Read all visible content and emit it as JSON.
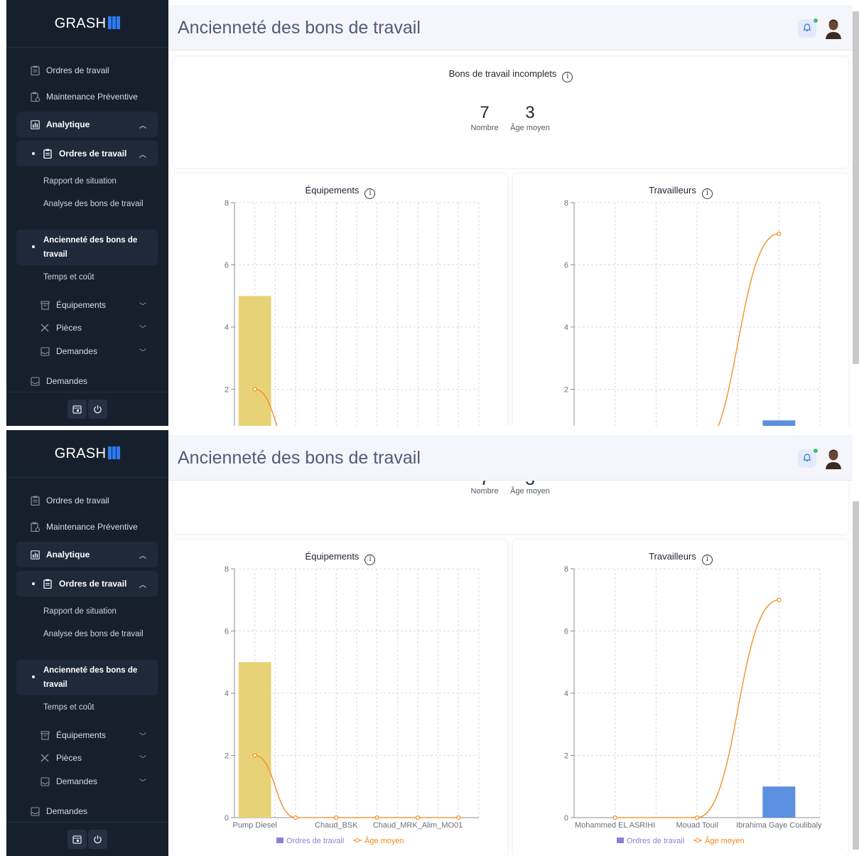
{
  "app": {
    "logo_text": "GRASH",
    "page_title": "Ancienneté des bons de travail"
  },
  "sidebar": {
    "items": [
      {
        "label": "Ordres de travail",
        "icon": "clipboard-icon"
      },
      {
        "label": "Maintenance Préventive",
        "icon": "clipboard-clock-icon"
      },
      {
        "label": "Analytique",
        "icon": "analytics-icon"
      }
    ],
    "analytics_group": {
      "label": "Ordres de travail",
      "icon": "document-icon"
    },
    "subitems": [
      {
        "label": "Rapport de situation"
      },
      {
        "label": "Analyse des bons de travail"
      },
      {
        "label": "Ancienneté des bons de travail"
      },
      {
        "label": "Temps et coût"
      }
    ],
    "groups": [
      {
        "label": "Équipements",
        "icon": "archive-icon"
      },
      {
        "label": "Pièces",
        "icon": "tools-icon"
      },
      {
        "label": "Demandes",
        "icon": "inbox-icon"
      }
    ],
    "bottom_item": {
      "label": "Demandes",
      "icon": "inbox-icon"
    },
    "footer_buttons": [
      "calendar-icon",
      "power-icon"
    ]
  },
  "header": {
    "notification_dot_color": "#39c46b"
  },
  "summary": {
    "title": "Bons de travail incomplets",
    "count_value": "7",
    "count_label": "Nombre",
    "age_value": "3",
    "age_label": "Âge moyen"
  },
  "chart_data": [
    {
      "type": "bar",
      "title": "Équipements",
      "categories": [
        "Pump Diesel",
        "",
        "Chaud_BSK",
        "",
        "Chaud_MRK_Alim_MO01",
        ""
      ],
      "tick_labels": [
        "Pump Diesel",
        "Chaud_BSK",
        "Chaud_MRK_Alim_MO01"
      ],
      "series": [
        {
          "name": "Ordres de travail",
          "type": "bar",
          "values": [
            5,
            0,
            0,
            0,
            0,
            0
          ],
          "color": "#e8d277",
          "legend_color": "#8b80d6"
        },
        {
          "name": "Âge moyen",
          "type": "line",
          "values": [
            2,
            0,
            0,
            0,
            0,
            0
          ],
          "color": "#f28a1d"
        }
      ],
      "ylim": [
        0,
        8
      ],
      "yticks": [
        0,
        2,
        4,
        6,
        8
      ],
      "grid": true,
      "legend": "bottom"
    },
    {
      "type": "bar",
      "title": "Travailleurs",
      "categories": [
        "Mohammed EL ASRIHI",
        "Mouad Touil",
        "Ibrahima Gaye Coulibaly"
      ],
      "tick_labels": [
        "Mohammed EL ASRIHI",
        "Mouad Touil",
        "Ibrahima Gaye Coulibaly"
      ],
      "series": [
        {
          "name": "Ordres de travail",
          "type": "bar",
          "values": [
            0,
            0,
            1
          ],
          "color": "#5b8fe0",
          "legend_color": "#8b80d6"
        },
        {
          "name": "Âge moyen",
          "type": "line",
          "values": [
            0,
            0,
            7
          ],
          "color": "#f28a1d"
        }
      ],
      "ylim": [
        0,
        8
      ],
      "yticks": [
        0,
        2,
        4,
        6,
        8
      ],
      "grid": true,
      "legend": "bottom"
    }
  ]
}
